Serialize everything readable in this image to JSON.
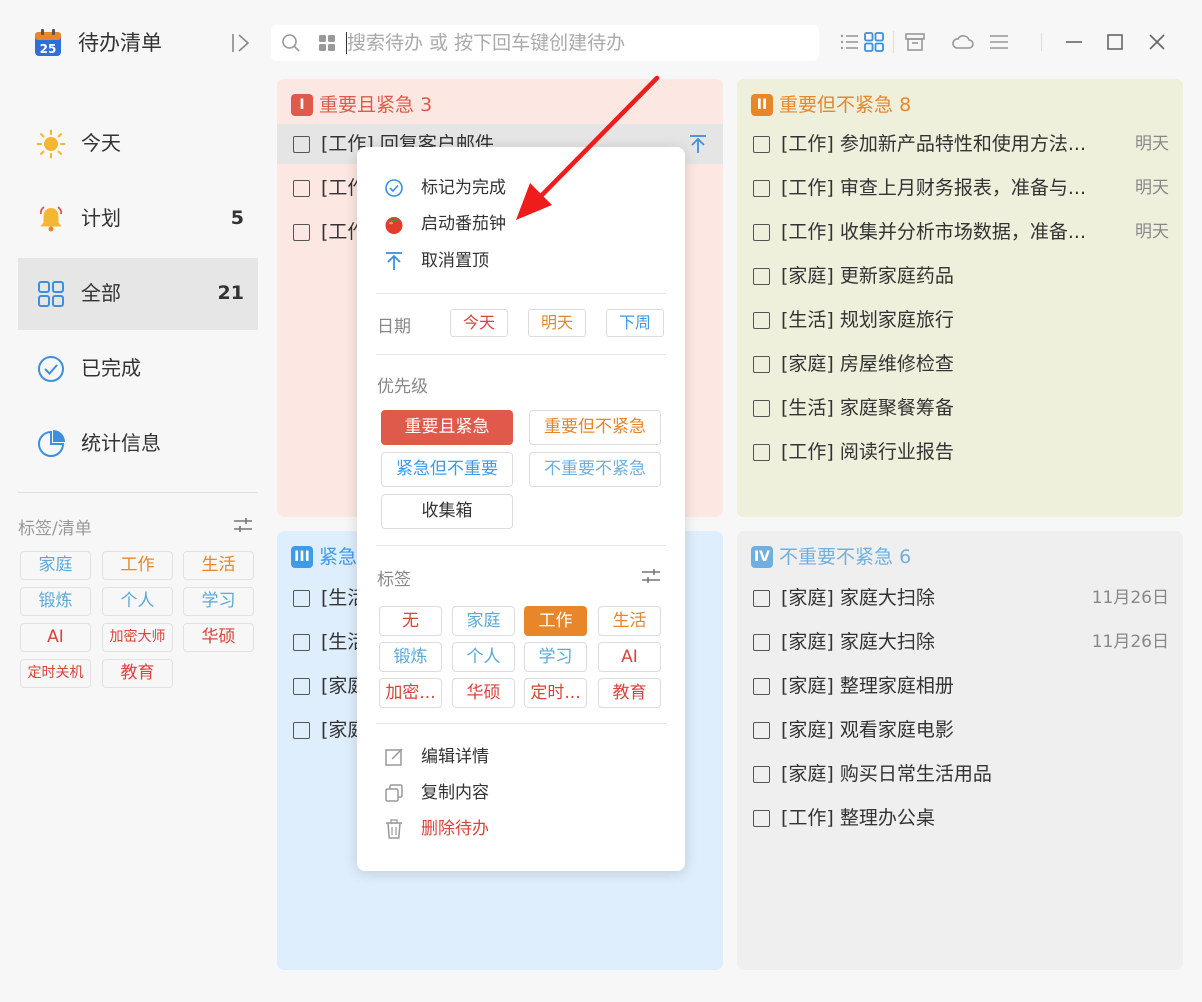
{
  "app": {
    "title": "待办清单",
    "logo_text": "25"
  },
  "search": {
    "placeholder": "搜索待办 或 按下回车键创建待办"
  },
  "toolbar": {
    "icons": [
      "list-icon",
      "grid-icon",
      "archive-icon",
      "cloud-icon",
      "menu-icon",
      "minimize-icon",
      "maximize-icon",
      "close-icon"
    ]
  },
  "nav": [
    {
      "label": "今天",
      "count": "",
      "icon": "sun-icon"
    },
    {
      "label": "计划",
      "count": "5",
      "icon": "bell-icon"
    },
    {
      "label": "全部",
      "count": "21",
      "icon": "grid-icon"
    },
    {
      "label": "已完成",
      "count": "",
      "icon": "check-circle-icon"
    },
    {
      "label": "统计信息",
      "count": "",
      "icon": "pie-chart-icon"
    }
  ],
  "tags_section": {
    "title": "标签/清单",
    "tags": [
      {
        "label": "家庭",
        "color": "#5aa9d6"
      },
      {
        "label": "工作",
        "color": "#e8862a"
      },
      {
        "label": "生活",
        "color": "#e8862a"
      },
      {
        "label": "锻炼",
        "color": "#5aa9d6"
      },
      {
        "label": "个人",
        "color": "#5aa9d6"
      },
      {
        "label": "学习",
        "color": "#5aa9d6"
      },
      {
        "label": "AI",
        "color": "#d9443a"
      },
      {
        "label": "加密大师",
        "color": "#d9443a"
      },
      {
        "label": "华硕",
        "color": "#d9443a"
      },
      {
        "label": "定时关机",
        "color": "#d9443a"
      },
      {
        "label": "教育",
        "color": "#d9443a"
      }
    ]
  },
  "quadrants": [
    {
      "badge": "I",
      "title": "重要且紧急",
      "count": "3",
      "color": "#e05a4b",
      "items": [
        {
          "text": "[工作] 回复客户邮件",
          "date": "",
          "selected": true
        },
        {
          "text": "[工作",
          "date": ""
        },
        {
          "text": "[工作",
          "date": ""
        }
      ]
    },
    {
      "badge": "II",
      "title": "重要但不紧急",
      "count": "8",
      "color": "#e8862a",
      "items": [
        {
          "text": "[工作] 参加新产品特性和使用方法...",
          "date": "明天"
        },
        {
          "text": "[工作] 审查上月财务报表，准备与...",
          "date": "明天"
        },
        {
          "text": "[工作] 收集并分析市场数据，准备...",
          "date": "明天"
        },
        {
          "text": "[家庭] 更新家庭药品",
          "date": ""
        },
        {
          "text": "[生活] 规划家庭旅行",
          "date": ""
        },
        {
          "text": "[家庭] 房屋维修检查",
          "date": ""
        },
        {
          "text": "[生活] 家庭聚餐筹备",
          "date": ""
        },
        {
          "text": "[工作] 阅读行业报告",
          "date": ""
        }
      ]
    },
    {
      "badge": "III",
      "title": "紧急",
      "count": "",
      "color": "#3d9be9",
      "items": [
        {
          "text": "[生活",
          "date": ""
        },
        {
          "text": "[生活",
          "date": ""
        },
        {
          "text": "[家庭",
          "date": ""
        },
        {
          "text": "[家庭",
          "date": ""
        }
      ]
    },
    {
      "badge": "IV",
      "title": "不重要不紧急",
      "count": "6",
      "color": "#6fb0e0",
      "items": [
        {
          "text": "[家庭] 家庭大扫除",
          "date": "11月26日"
        },
        {
          "text": "[家庭] 家庭大扫除",
          "date": "11月26日"
        },
        {
          "text": "[家庭] 整理家庭相册",
          "date": ""
        },
        {
          "text": "[家庭] 观看家庭电影",
          "date": ""
        },
        {
          "text": "[家庭] 购买日常生活用品",
          "date": ""
        },
        {
          "text": "[工作] 整理办公桌",
          "date": ""
        }
      ]
    }
  ],
  "context_menu": {
    "actions": [
      {
        "label": "标记为完成",
        "icon": "check-circle-icon"
      },
      {
        "label": "启动番茄钟",
        "icon": "tomato-icon"
      },
      {
        "label": "取消置顶",
        "icon": "unpin-icon"
      }
    ],
    "date_label": "日期",
    "dates": [
      {
        "label": "今天",
        "color": "#d9443a"
      },
      {
        "label": "明天",
        "color": "#e8862a"
      },
      {
        "label": "下周",
        "color": "#3d9be9"
      }
    ],
    "priority_label": "优先级",
    "priorities": [
      {
        "label": "重要且紧急",
        "color": "#e05a4b",
        "active": true
      },
      {
        "label": "重要但不紧急",
        "color": "#e8862a"
      },
      {
        "label": "紧急但不重要",
        "color": "#3d9be9"
      },
      {
        "label": "不重要不紧急",
        "color": "#6fb0e0"
      },
      {
        "label": "收集箱",
        "color": "#333333"
      }
    ],
    "tag_label": "标签",
    "tags": [
      {
        "label": "无",
        "color": "#d9443a"
      },
      {
        "label": "家庭",
        "color": "#5aa9d6"
      },
      {
        "label": "工作",
        "color": "#e8862a",
        "active": true
      },
      {
        "label": "生活",
        "color": "#e8862a"
      },
      {
        "label": "锻炼",
        "color": "#5aa9d6"
      },
      {
        "label": "个人",
        "color": "#5aa9d6"
      },
      {
        "label": "学习",
        "color": "#5aa9d6"
      },
      {
        "label": "AI",
        "color": "#d9443a"
      },
      {
        "label": "加密...",
        "color": "#d9443a"
      },
      {
        "label": "华硕",
        "color": "#d9443a"
      },
      {
        "label": "定时...",
        "color": "#d9443a"
      },
      {
        "label": "教育",
        "color": "#d9443a"
      }
    ],
    "bottom_actions": [
      {
        "label": "编辑详情",
        "icon": "edit-icon"
      },
      {
        "label": "复制内容",
        "icon": "copy-icon"
      },
      {
        "label": "删除待办",
        "icon": "trash-icon",
        "danger": true
      }
    ]
  }
}
